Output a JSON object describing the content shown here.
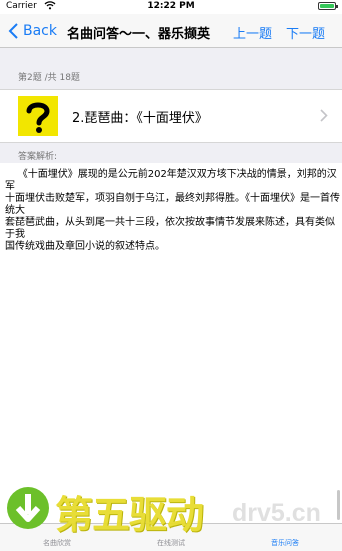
{
  "status_bar": {
    "carrier": "Carrier",
    "time": "12:22 PM"
  },
  "nav": {
    "back_label": "Back",
    "title": "名曲问答～一、器乐撷英",
    "prev_label": "上一题",
    "next_label": "下一题"
  },
  "question": {
    "progress": "第2题 /共 18题",
    "title": "2.琵琶曲：《十面埋伏》",
    "icon": "question-mark-icon"
  },
  "answer": {
    "label": "答案解析:",
    "text": "    《十面埋伏》展现的是公元前202年楚汉双方垓下决战的情景，刘邦的汉军\n十面埋伏击败楚军，项羽自刎于乌江，最终刘邦得胜。《十面埋伏》是一首传统大\n套琵琶武曲，从头到尾一共十三段，依次按故事情节发展来陈述，具有类似于我\n国传统戏曲及章回小说的叙述特点。"
  },
  "tabs": [
    {
      "label": "名曲欣赏"
    },
    {
      "label": "在线测试"
    },
    {
      "label": "音乐问答"
    }
  ],
  "watermark": {
    "cn": "第五驱动",
    "en": "drv5.cn"
  },
  "colors": {
    "accent": "#1a7cf5",
    "icon_yellow": "#f2e600"
  }
}
